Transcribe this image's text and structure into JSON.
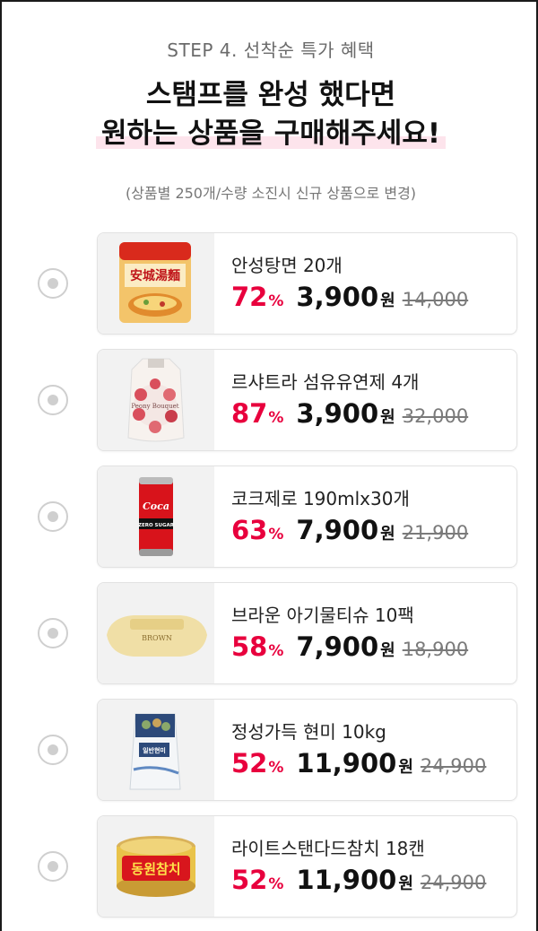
{
  "header": {
    "step": "STEP 4. 선착순 특가 혜택",
    "title_line1": "스탬프를 완성 했다면",
    "title_line2": "원하는 상품을 구매해주세요!",
    "note": "(상품별 250개/수량 소진시 신규 상품으로 변경)"
  },
  "colors": {
    "accent": "#e8003d",
    "highlight": "#fde4ec",
    "card_border": "#e2e2e2"
  },
  "products": [
    {
      "name": "안성탕면 20개",
      "discount": "72",
      "pct_sign": "%",
      "price": "3,900",
      "won": "원",
      "original": "14,000",
      "image_icon": "ramen-package-icon",
      "image_text": "安城湯麵"
    },
    {
      "name": "르샤트라 섬유유연제 4개",
      "discount": "87",
      "pct_sign": "%",
      "price": "3,900",
      "won": "원",
      "original": "32,000",
      "image_icon": "fabric-softener-pouch-icon",
      "image_text": "Peony Bouquet"
    },
    {
      "name": "코크제로 190mlx30개",
      "discount": "63",
      "pct_sign": "%",
      "price": "7,900",
      "won": "원",
      "original": "21,900",
      "image_icon": "coke-can-icon",
      "image_text": "ZERO SUGAR"
    },
    {
      "name": "브라운 아기물티슈 10팩",
      "discount": "58",
      "pct_sign": "%",
      "price": "7,900",
      "won": "원",
      "original": "18,900",
      "image_icon": "wet-tissue-pack-icon",
      "image_text": "BROWN"
    },
    {
      "name": "정성가득 현미 10kg",
      "discount": "52",
      "pct_sign": "%",
      "price": "11,900",
      "won": "원",
      "original": "24,900",
      "image_icon": "rice-bag-icon",
      "image_text": "일반현미"
    },
    {
      "name": "라이트스탠다드참치 18캔",
      "discount": "52",
      "pct_sign": "%",
      "price": "11,900",
      "won": "원",
      "original": "24,900",
      "image_icon": "tuna-can-icon",
      "image_text": "동원참치"
    }
  ]
}
